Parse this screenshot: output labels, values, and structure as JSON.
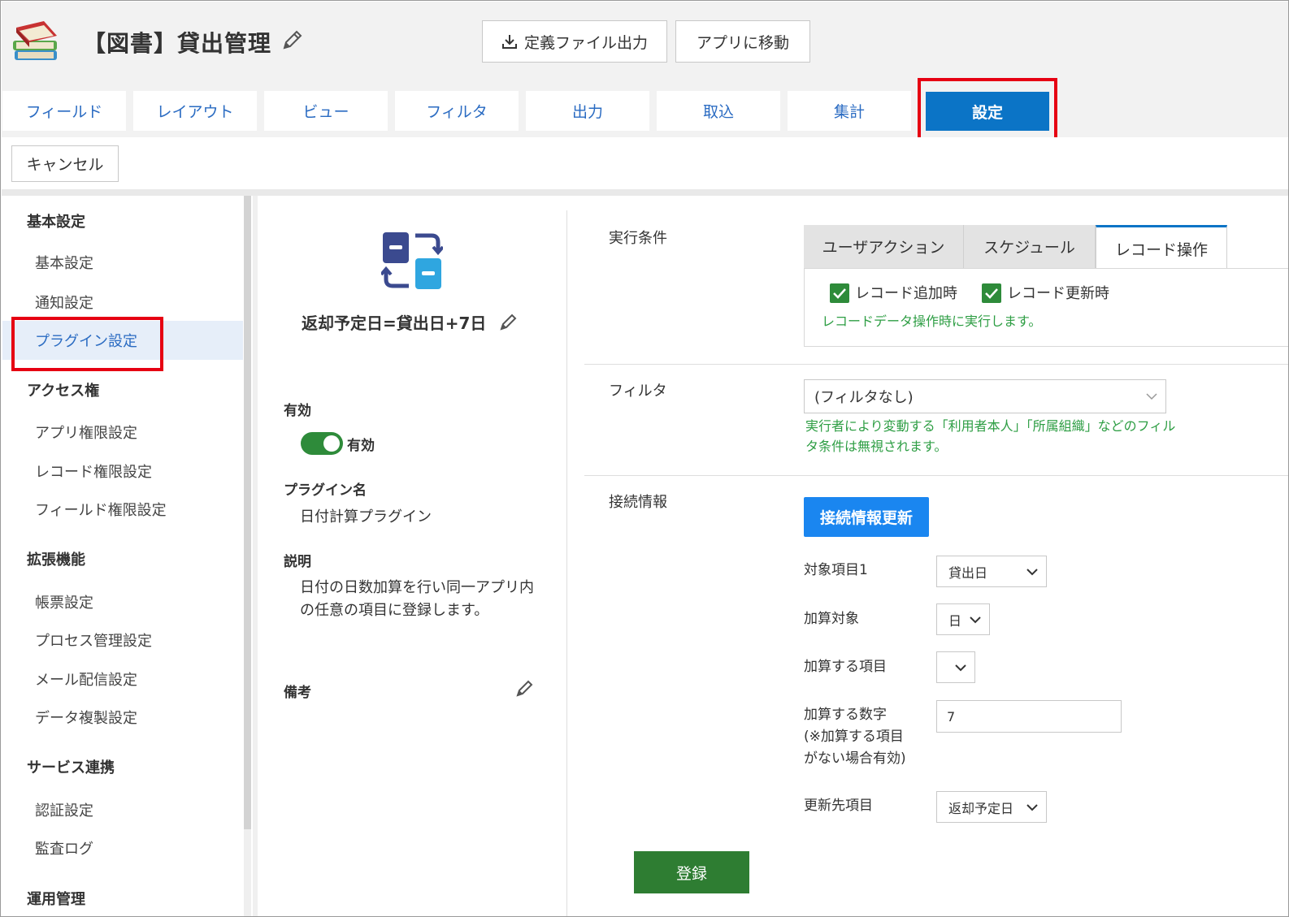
{
  "header": {
    "app_title": "【図書】貸出管理",
    "export_button": "定義ファイル出力",
    "go_to_app_button": "アプリに移動"
  },
  "tabs": [
    {
      "label": "フィールド"
    },
    {
      "label": "レイアウト"
    },
    {
      "label": "ビュー"
    },
    {
      "label": "フィルタ"
    },
    {
      "label": "出力"
    },
    {
      "label": "取込"
    },
    {
      "label": "集計"
    },
    {
      "label": "設定",
      "active": true
    }
  ],
  "cancel_button": "キャンセル",
  "sidebar": {
    "sections": [
      {
        "title": "基本設定",
        "items": [
          "基本設定",
          "通知設定",
          "プラグイン設定"
        ]
      },
      {
        "title": "アクセス権",
        "items": [
          "アプリ権限設定",
          "レコード権限設定",
          "フィールド権限設定"
        ]
      },
      {
        "title": "拡張機能",
        "items": [
          "帳票設定",
          "プロセス管理設定",
          "メール配信設定",
          "データ複製設定"
        ]
      },
      {
        "title": "サービス連携",
        "items": [
          "認証設定",
          "監査ログ"
        ]
      },
      {
        "title": "運用管理",
        "items": []
      }
    ],
    "active_item": "プラグイン設定"
  },
  "plugin": {
    "title": "返却予定日=貸出日+7日",
    "enabled_label": "有効",
    "enabled_toggle_text": "有効",
    "enabled": true,
    "name_label": "プラグイン名",
    "name_value": "日付計算プラグイン",
    "description_label": "説明",
    "description_line1": "日付の日数加算を行い同一アプリ内",
    "description_line2": "の任意の項目に登録します。",
    "remarks_label": "備考"
  },
  "execution": {
    "label": "実行条件",
    "tabs": [
      "ユーザアクション",
      "スケジュール",
      "レコード操作"
    ],
    "active_tab": "レコード操作",
    "checkboxes": [
      {
        "label": "レコード追加時",
        "checked": true
      },
      {
        "label": "レコード更新時",
        "checked": true
      }
    ],
    "note": "レコードデータ操作時に実行します。"
  },
  "filter": {
    "label": "フィルタ",
    "value": "(フィルタなし)",
    "note_line1": "実行者により変動する「利用者本人」「所属組織」などのフィル",
    "note_line2": "タ条件は無視されます。"
  },
  "connection": {
    "label": "接続情報",
    "update_button": "接続情報更新",
    "fields": {
      "target_item_label": "対象項目1",
      "target_item_value": "貸出日",
      "add_target_label": "加算対象",
      "add_target_value": "日",
      "add_item_label": "加算する項目",
      "add_item_value": "",
      "add_number_label_line1": "加算する数字",
      "add_number_label_line2": "(※加算する項目",
      "add_number_label_line3": "がない場合有効)",
      "add_number_value": "7",
      "update_dest_label": "更新先項目",
      "update_dest_value": "返却予定日"
    }
  },
  "submit_button": "登録",
  "colors": {
    "accent_blue": "#0b74c6",
    "link_blue": "#2a6bc2",
    "green": "#2e8b3a",
    "highlight_red": "#e60012"
  }
}
